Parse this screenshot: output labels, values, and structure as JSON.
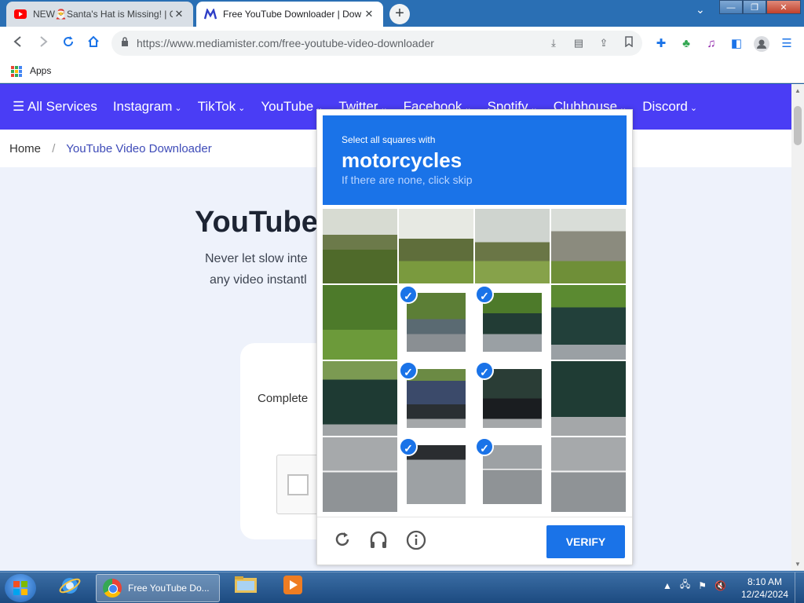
{
  "browser": {
    "tabs": [
      {
        "title": "NEW🎅Santa's Hat is Missing! | C",
        "close": "✕",
        "favicon": "youtube-icon"
      },
      {
        "title": "Free YouTube Downloader | Dow",
        "close": "✕",
        "favicon": "mediamister-icon"
      }
    ],
    "new_tab": "+",
    "tab_menu": "⌄",
    "window_controls": {
      "minimize": "—",
      "maximize": "❐",
      "close": "✕"
    },
    "url": "https://www.mediamister.com/free-youtube-video-downloader",
    "bookmarks": {
      "apps_label": "Apps"
    }
  },
  "site": {
    "nav": [
      {
        "label": "☰ All Services",
        "caret": ""
      },
      {
        "label": "Instagram",
        "caret": "⌄"
      },
      {
        "label": "TikTok",
        "caret": "⌄"
      },
      {
        "label": "YouTube",
        "caret": "⌄"
      },
      {
        "label": "Twitter",
        "caret": "⌄"
      },
      {
        "label": "Facebook",
        "caret": "⌄"
      },
      {
        "label": "Spotify",
        "caret": "⌄"
      },
      {
        "label": "Clubhouse",
        "caret": "⌄"
      },
      {
        "label": "Discord",
        "caret": "⌄"
      }
    ],
    "breadcrumb": {
      "home": "Home",
      "separator": "/",
      "current": "YouTube Video Downloader"
    },
    "hero": {
      "title": "YouTube",
      "subtitle_line1": "Never let slow inte",
      "subtitle_line2": "any video instantl"
    },
    "card": {
      "text": "Complete "
    }
  },
  "captcha": {
    "instruction": "Select all squares with",
    "target": "motorcycles",
    "hint": "If there are none, click skip",
    "verify_label": "VERIFY",
    "check_mark": "✓",
    "tiles": [
      {
        "selected": false
      },
      {
        "selected": false
      },
      {
        "selected": false
      },
      {
        "selected": false
      },
      {
        "selected": false
      },
      {
        "selected": true
      },
      {
        "selected": true
      },
      {
        "selected": false
      },
      {
        "selected": false
      },
      {
        "selected": true
      },
      {
        "selected": true
      },
      {
        "selected": false
      },
      {
        "selected": false
      },
      {
        "selected": true
      },
      {
        "selected": true
      },
      {
        "selected": false
      }
    ],
    "footer_icons": [
      "refresh-icon",
      "headphones-icon",
      "info-icon"
    ]
  },
  "taskbar": {
    "active_task": "Free YouTube Do...",
    "time": "8:10 AM",
    "date": "12/24/2024"
  },
  "colors": {
    "site_nav": "#4a3df5",
    "captcha_blue": "#1a73e8",
    "page_bg": "#eef2fb"
  }
}
